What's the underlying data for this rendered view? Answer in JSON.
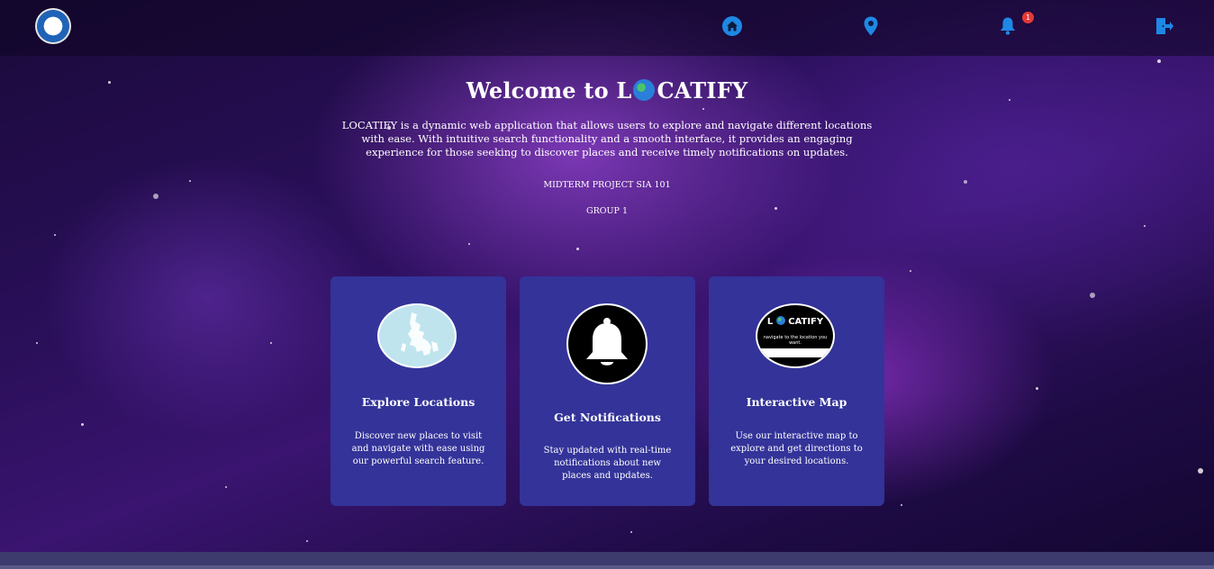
{
  "nav": {
    "logo_icon": "university-seal-icon",
    "items": [
      {
        "icon": "home-icon",
        "color": "#1e88e5"
      },
      {
        "icon": "location-pin-icon",
        "color": "#1e88e5"
      },
      {
        "icon": "bell-icon",
        "color": "#1e88e5"
      },
      {
        "icon": "logout-icon",
        "color": "#1e88e5"
      }
    ],
    "notification_count": "1"
  },
  "hero": {
    "title_prefix": "Welcome to L",
    "title_suffix": "CATIFY",
    "description": "LOCATIFY is a dynamic web application that allows users to explore and navigate different locations with ease. With intuitive search functionality and a smooth interface, it provides an engaging experience for those seeking to discover places and receive timely notifications on updates.",
    "project": "MIDTERM PROJECT SIA 101",
    "group": "GROUP 1"
  },
  "cards": [
    {
      "title": "Explore Locations",
      "description": "Discover new places to visit and navigate with ease using our powerful search feature.",
      "image": "philippines-map-icon"
    },
    {
      "title": "Get Notifications",
      "description": "Stay updated with real-time notifications about new places and updates.",
      "image": "bell-icon"
    },
    {
      "title": "Interactive Map",
      "description": "Use our interactive map to explore and get directions to your desired locations.",
      "image_logo_prefix": "L",
      "image_logo_suffix": "CATIFY",
      "image_tagline": "navigate to the location you want."
    }
  ],
  "colors": {
    "card_bg": "#333399",
    "accent": "#1e88e5",
    "badge": "#e53935"
  }
}
